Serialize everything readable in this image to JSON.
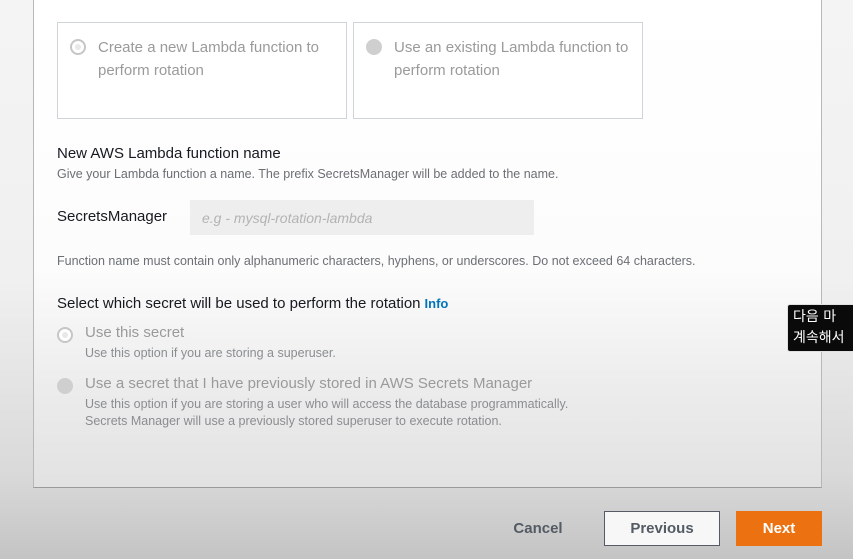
{
  "rotation_function": {
    "options": [
      {
        "label": "Create a new Lambda function to perform rotation",
        "selected": false
      },
      {
        "label": "Use an existing Lambda function to perform rotation",
        "selected": false
      }
    ]
  },
  "lambda_name": {
    "title": "New AWS Lambda function name",
    "description": "Give your Lambda function a name. The prefix SecretsManager will be added to the name.",
    "prefix": "SecretsManager",
    "value": "",
    "placeholder": "e.g - mysql-rotation-lambda",
    "constraint": "Function name must contain only alphanumeric characters, hyphens, or underscores. Do not exceed 64 characters."
  },
  "secret_selection": {
    "title": "Select which secret will be used to perform the rotation",
    "info_label": "Info",
    "options": [
      {
        "label": "Use this secret",
        "description": "Use this option if you are storing a superuser.",
        "selected": false
      },
      {
        "label": "Use a secret that I have previously stored in AWS Secrets Manager",
        "description": "Use this option if you are storing a user who will access the database programmatically. Secrets Manager will use a previously stored superuser to execute rotation.",
        "selected": false
      }
    ]
  },
  "footer": {
    "cancel_label": "Cancel",
    "previous_label": "Previous",
    "next_label": "Next",
    "primary_color": "#ec7211"
  },
  "subtitle": {
    "line1": "다음 마",
    "line2": "계속해서"
  }
}
